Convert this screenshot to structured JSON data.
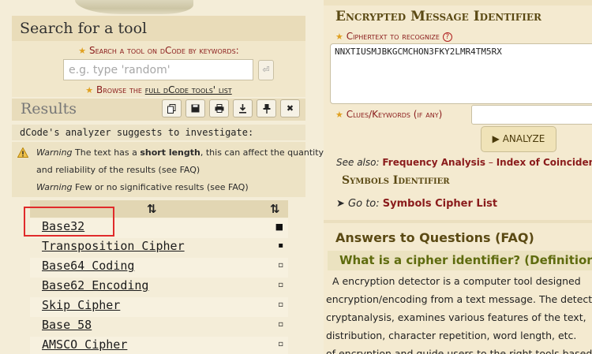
{
  "search": {
    "heading": "Search for a tool",
    "keywords_label": "Search a tool on dCode by keywords:",
    "placeholder": "e.g. type 'random'",
    "go_icon": "arrow-return-icon",
    "browse_prefix": "Browse the",
    "browse_link": "full dCode tools' list"
  },
  "results": {
    "title": "Results",
    "toolbar_icons": [
      "copy-icon",
      "save-icon",
      "print-icon",
      "download-icon",
      "pin-icon",
      "close-icon"
    ],
    "analyzer_text": "dCode's analyzer suggests to investigate:",
    "warning1_label": "Warning",
    "warning1_text_a": "The text has a",
    "warning1_bold": "short length",
    "warning1_text_b": ", this can affect the quantity",
    "warning1_line2": "and reliability of the results (see FAQ)",
    "warning2_label": "Warning",
    "warning2_text": "Few or no significative results (see FAQ)",
    "sort_icon": "⇅",
    "rows": [
      {
        "name": "Base32",
        "score_icon": "■"
      },
      {
        "name": "Transposition Cipher",
        "score_icon": "▪"
      },
      {
        "name": "Base64 Coding",
        "score_icon": "▫"
      },
      {
        "name": "Base62 Encoding",
        "score_icon": "▫"
      },
      {
        "name": "Skip Cipher",
        "score_icon": "▫"
      },
      {
        "name": "Base 58",
        "score_icon": "▫"
      },
      {
        "name": "AMSCO Cipher",
        "score_icon": "▫"
      }
    ]
  },
  "tool": {
    "title": "Encrypted Message Identifier",
    "cipher_label": "Ciphertext to recognize",
    "cipher_value": "NNXTIUSMJBKGCMCHON3FKY2LMR4TM5RX",
    "clues_label": "Clues/Keywords (if any)",
    "clues_value": "",
    "analyze_label": "▶ ANALYZE",
    "see_also_label": "See also:",
    "see_also_link1": "Frequency Analysis",
    "see_also_sep": "–",
    "see_also_link2": "Index of Coincidence",
    "symbols_title": "Symbols Identifier",
    "goto_label": "Go to:",
    "goto_link": "Symbols Cipher List"
  },
  "faq": {
    "title": "Answers to Questions (FAQ)",
    "question": "What is a cipher identifier? (Definition)",
    "lines": [
      "  A encryption detector is a computer tool designed",
      "encryption/encoding from a text message. The detector",
      "cryptanalysis, examines various features of the text,",
      "distribution, character repetition, word length, etc.",
      "of encryption and guide users to the right tools based"
    ]
  },
  "colors": {
    "link_red": "#8a1b1b",
    "title_gold": "#5b4a14",
    "highlight": "#e02b2b"
  }
}
